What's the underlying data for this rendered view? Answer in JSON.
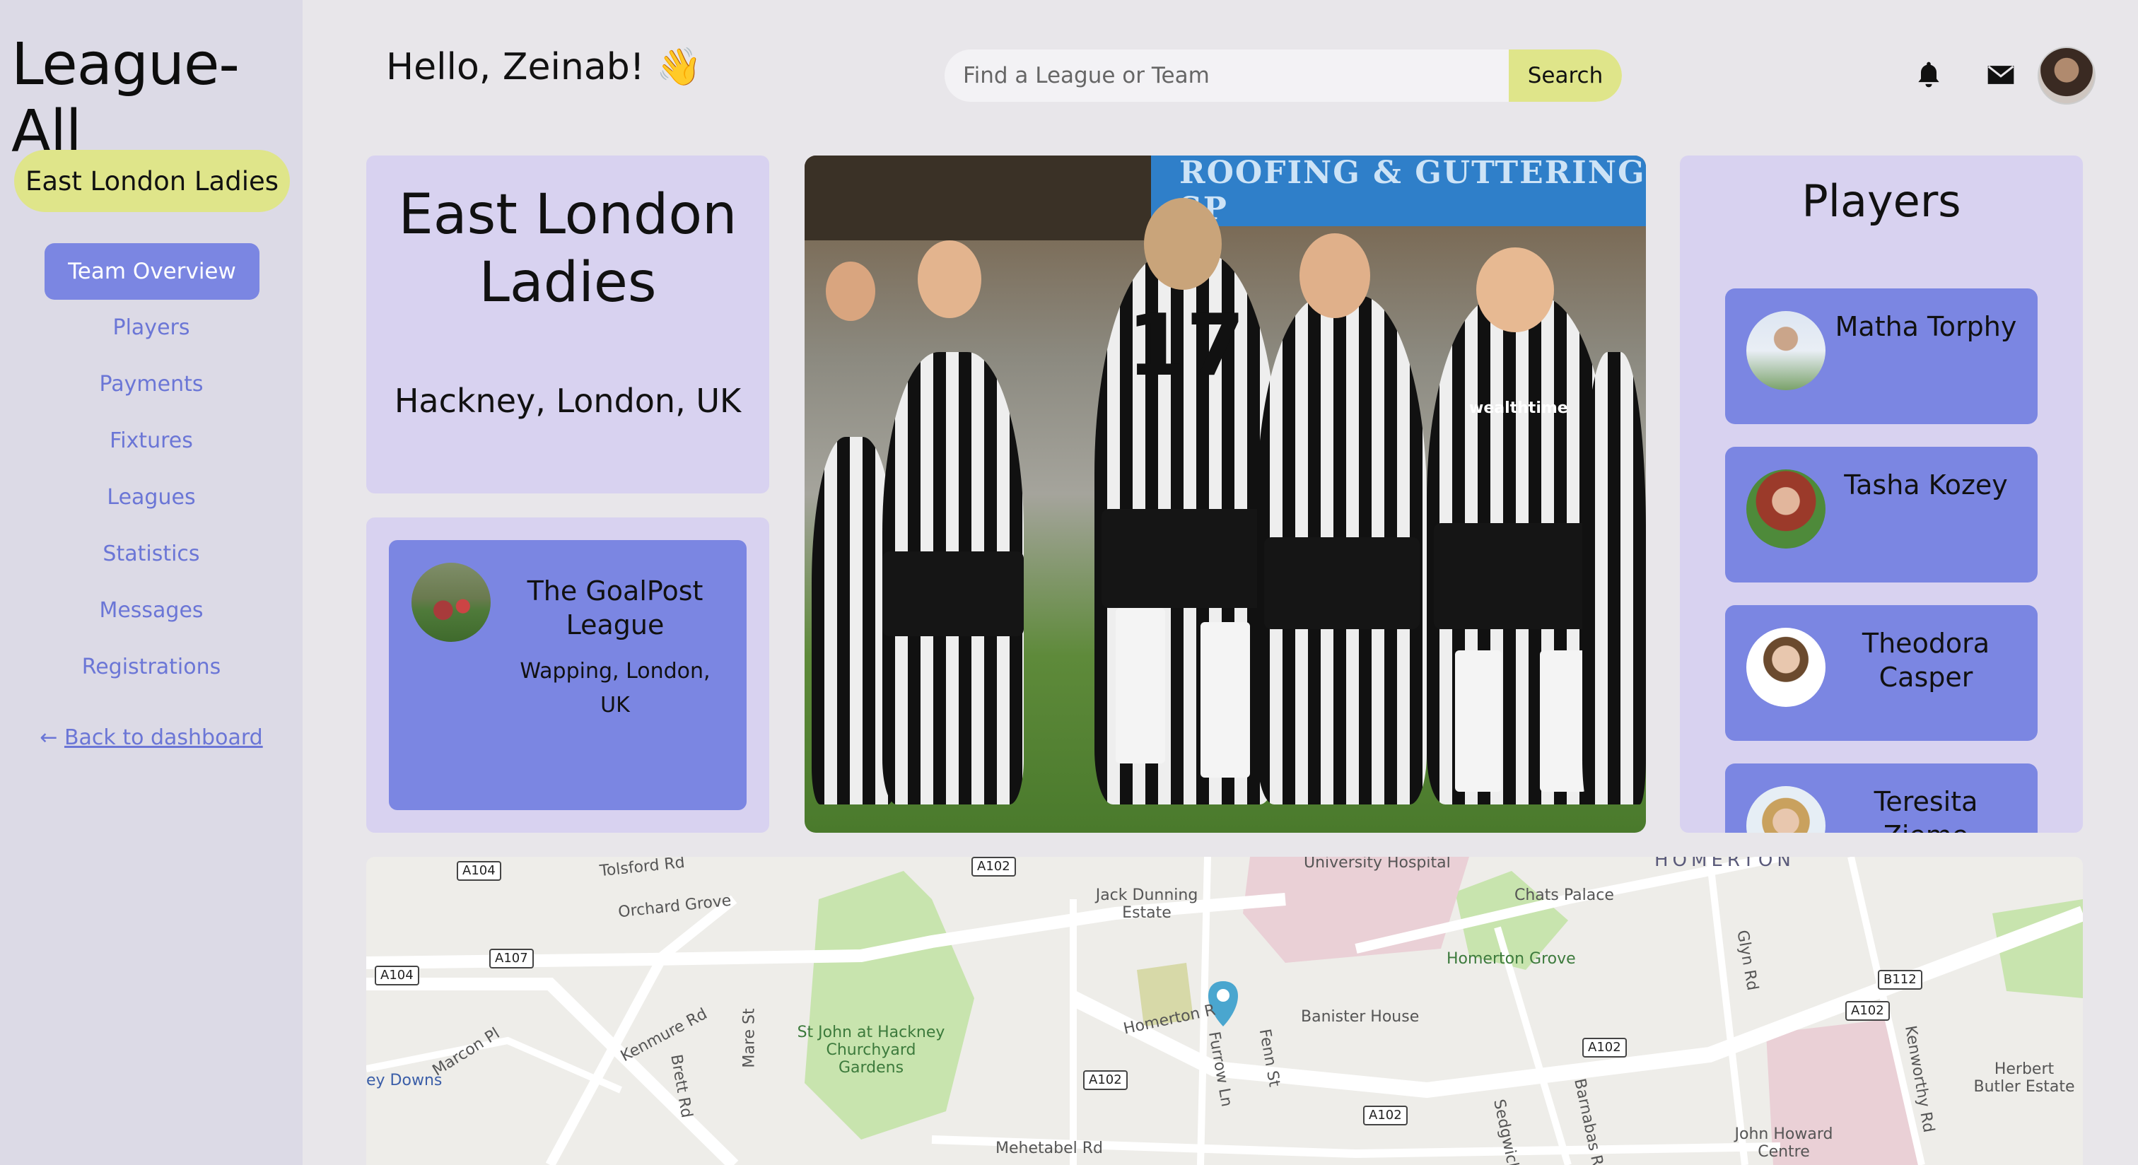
{
  "app": {
    "logo": "League-All"
  },
  "sidebar": {
    "team_pill": "East London Ladies",
    "active_item": "Team Overview",
    "items": [
      "Players",
      "Payments",
      "Fixtures",
      "Leagues",
      "Statistics",
      "Messages",
      "Registrations"
    ],
    "back_arrow": "←",
    "back_label": "Back to dashboard"
  },
  "header": {
    "greeting": "Hello, Zeinab! 👋",
    "search_placeholder": "Find a League or Team",
    "search_button": "Search",
    "icons": [
      "bell-icon",
      "mail-icon",
      "user-avatar"
    ]
  },
  "team": {
    "name": "East London Ladies",
    "location": "Hackney, London, UK"
  },
  "league": {
    "name": "The GoalPost League",
    "location": "Wapping, London, UK"
  },
  "photo": {
    "banner_text": "ROOFING & GUTTERING SP",
    "shirt_number": "17",
    "sponsor": "wealthtime"
  },
  "players": {
    "title": "Players",
    "list": [
      {
        "name": "Matha Torphy"
      },
      {
        "name": "Tasha Kozey"
      },
      {
        "name": "Theodora Casper"
      },
      {
        "name": "Teresita Zieme"
      }
    ]
  },
  "map": {
    "labels": [
      "Tolsford Rd",
      "Orchard Grove",
      "University Hospital",
      "Jack Dunning Estate",
      "Chats Palace",
      "HOMERTON",
      "Homerton Grove",
      "Banister House",
      "Homerton R",
      "St John at Hackney Churchyard Gardens",
      "Kenmure Rd",
      "Mare St",
      "Brett Rd",
      "Marcon Pl",
      "ey Downs",
      "Furrow Ln",
      "Fenn St",
      "Glyn Rd",
      "Kenworthy Rd",
      "Herbert Butler Estate",
      "John Howard Centre",
      "Barnabas Rd",
      "Sedgwick",
      "Mehetabel Rd"
    ],
    "road_badges": [
      "A104",
      "A102",
      "A107",
      "A104",
      "A102",
      "A102",
      "A102",
      "A102",
      "B112"
    ]
  },
  "colors": {
    "accent_yellow": "#dfe58a",
    "accent_blue": "#7b86e2",
    "card_lavender": "#d8d2f0",
    "nav_text": "#6b76d6"
  }
}
